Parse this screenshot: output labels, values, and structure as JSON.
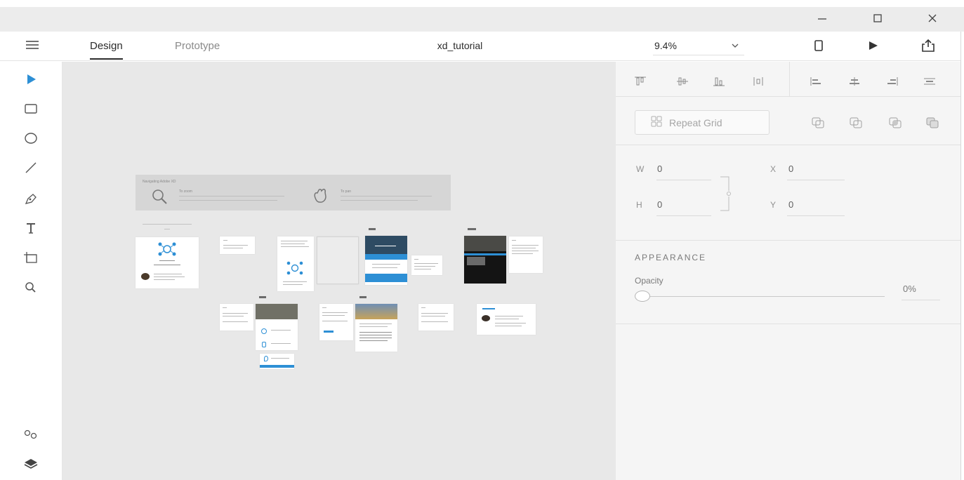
{
  "window": {
    "controls": [
      {
        "name": "minimize-button",
        "icon": "minimize-icon"
      },
      {
        "name": "maximize-button",
        "icon": "maximize-icon"
      },
      {
        "name": "close-button",
        "icon": "close-icon"
      }
    ]
  },
  "appbar": {
    "tabs": [
      {
        "label": "Design",
        "active": true
      },
      {
        "label": "Prototype",
        "active": false
      }
    ],
    "document_title": "xd_tutorial",
    "zoom": "9.4%",
    "actions": [
      {
        "name": "device-preview-button",
        "icon": "device-icon"
      },
      {
        "name": "play-preview-button",
        "icon": "play-icon"
      },
      {
        "name": "share-button",
        "icon": "share-icon"
      }
    ]
  },
  "toolbar": {
    "tools": [
      {
        "name": "select-tool",
        "icon": "pointer-icon",
        "active": true
      },
      {
        "name": "rectangle-tool",
        "icon": "rectangle-icon"
      },
      {
        "name": "ellipse-tool",
        "icon": "ellipse-icon"
      },
      {
        "name": "line-tool",
        "icon": "line-icon"
      },
      {
        "name": "pen-tool",
        "icon": "pen-icon"
      },
      {
        "name": "text-tool",
        "icon": "text-icon"
      },
      {
        "name": "artboard-tool",
        "icon": "artboard-icon"
      },
      {
        "name": "zoom-tool",
        "icon": "zoom-icon"
      }
    ],
    "bottom": [
      {
        "name": "symbols-button",
        "icon": "symbols-icon"
      },
      {
        "name": "layers-button",
        "icon": "layers-icon"
      }
    ]
  },
  "canvas": {
    "banner_title": "Navigating Adobe XD",
    "banner_zoom_title": "To zoom",
    "banner_pan_title": "To pan"
  },
  "panel": {
    "align_icons": [
      "align-top-icon",
      "align-middle-icon",
      "align-bottom-icon",
      "distribute-vertical-icon",
      "align-left-icon",
      "align-center-icon",
      "align-right-icon",
      "distribute-horizontal-icon"
    ],
    "repeat_grid_label": "Repeat Grid",
    "boolean_icons": [
      "union-icon",
      "subtract-icon",
      "intersect-icon",
      "exclude-icon"
    ],
    "transform": {
      "w_label": "W",
      "w_value": "0",
      "h_label": "H",
      "h_value": "0",
      "x_label": "X",
      "x_value": "0",
      "y_label": "Y",
      "y_value": "0"
    },
    "appearance_heading": "APPEARANCE",
    "opacity_label": "Opacity",
    "opacity_value": "0%",
    "accent_color": "#2d8fd5"
  }
}
